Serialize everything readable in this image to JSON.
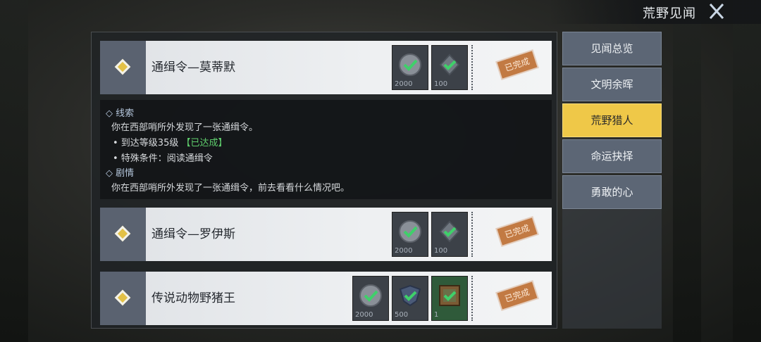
{
  "header": {
    "title": "荒野见闻"
  },
  "tabs": [
    {
      "label": "见闻总览",
      "active": false
    },
    {
      "label": "文明余晖",
      "active": false
    },
    {
      "label": "荒野猎人",
      "active": true
    },
    {
      "label": "命运抉择",
      "active": false
    },
    {
      "label": "勇敢的心",
      "active": false
    }
  ],
  "quests": [
    {
      "name": "通缉令—莫蒂默",
      "status": "已完成",
      "rewards": [
        {
          "icon": "coin-check-icon",
          "amount": "2000"
        },
        {
          "icon": "badge-check-icon",
          "amount": "100"
        }
      ]
    },
    {
      "name": "通缉令—罗伊斯",
      "status": "已完成",
      "rewards": [
        {
          "icon": "coin-check-icon",
          "amount": "2000"
        },
        {
          "icon": "badge-check-icon",
          "amount": "100"
        }
      ]
    },
    {
      "name": "传说动物野猪王",
      "status": "已完成",
      "rewards": [
        {
          "icon": "coin-check-icon",
          "amount": "2000"
        },
        {
          "icon": "emblem-check-icon",
          "amount": "500"
        },
        {
          "icon": "frame-check-icon",
          "amount": "1"
        }
      ]
    }
  ],
  "detail": {
    "clue_heading": "◇ 线索",
    "clue_text": "你在西部哨所外发现了一张通缉令。",
    "req1_text": "• 到达等级35级",
    "req1_status": "【已达成】",
    "req2_text": "• 特殊条件：阅读通缉令",
    "story_heading": "◇ 剧情",
    "story_text": "你在西部哨所外发现了一张通缉令，前去看看什么情况吧。"
  },
  "colors": {
    "accent": "#efc848",
    "stamp": "#c27a43",
    "achieved": "#5fcf6d"
  }
}
